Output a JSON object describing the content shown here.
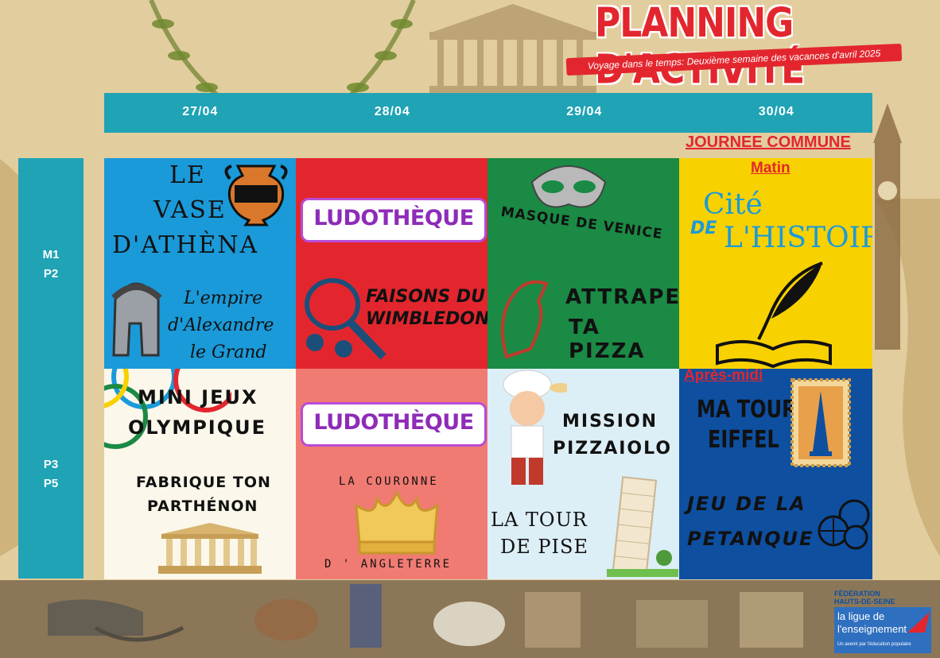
{
  "header": {
    "title": "PLANNING D'ACTIVITÉ",
    "subtitle": "Voyage dans le temps: Deuxième semaine des vacances d'avril 2025"
  },
  "days": [
    "27/04",
    "28/04",
    "29/04",
    "30/04"
  ],
  "slots": {
    "morning": [
      "M1",
      "P2"
    ],
    "afternoon": [
      "P3",
      "P5"
    ]
  },
  "journee_commune": "JOURNEE COMMUNE",
  "cells": {
    "d1_morning": {
      "title_line1": "LE",
      "title_line2": "VASE",
      "title_line3": "D'ATHÈNA",
      "sub_line1": "L'empire",
      "sub_line2": "d'Alexandre",
      "sub_line3": "le Grand"
    },
    "d2_morning": {
      "ludo": "LUDOTHÈQUE",
      "activity_line1": "FAISONS DU",
      "activity_line2": "WIMBLEDON"
    },
    "d3_morning": {
      "title": "MASQUE DE VENICE",
      "activity_line1": "ATTRAPE",
      "activity_line2": "TA PIZZA"
    },
    "d4_morning": {
      "label": "Matin",
      "cite_a": "Cité",
      "cite_b": "DE",
      "cite_c": "L'HISTOIRE"
    },
    "d1_afternoon": {
      "title_line1": "MINI JEUX",
      "title_line2": "OLYMPIQUE",
      "sub_line1": "FABRIQUE TON",
      "sub_line2": "PARTHÉNON"
    },
    "d2_afternoon": {
      "ludo": "LUDOTHÈQUE",
      "sub_line1": "LA COURONNE",
      "sub_line2": "D ' ANGLETERRE"
    },
    "d3_afternoon": {
      "title_line1": "MISSION",
      "title_line2": "PIZZAIOLO",
      "sub_line1": "LA TOUR",
      "sub_line2": "DE PISE"
    },
    "d4_afternoon": {
      "label": "Après-midi",
      "title_line1": "MA TOUR",
      "title_line2": "EIFFEL",
      "sub_line1": "JEU DE LA",
      "sub_line2": "PETANQUE"
    }
  },
  "logo": {
    "line1": "FÉDÉRATION",
    "line2": "HAUTS-DE-SEINE",
    "line3": "la ligue de",
    "line4": "l'enseignement",
    "tagline": "Un avenir par l'éducation populaire"
  },
  "colors": {
    "teal": "#1fa3b5",
    "red": "#e3262e",
    "blue": "#1a9ad9",
    "green": "#1a8a45",
    "yellow": "#f8d100",
    "darkblue": "#0e4fa0",
    "cream": "#fbf7ea",
    "salmon": "#f07b73",
    "lightblue": "#dceef6"
  }
}
